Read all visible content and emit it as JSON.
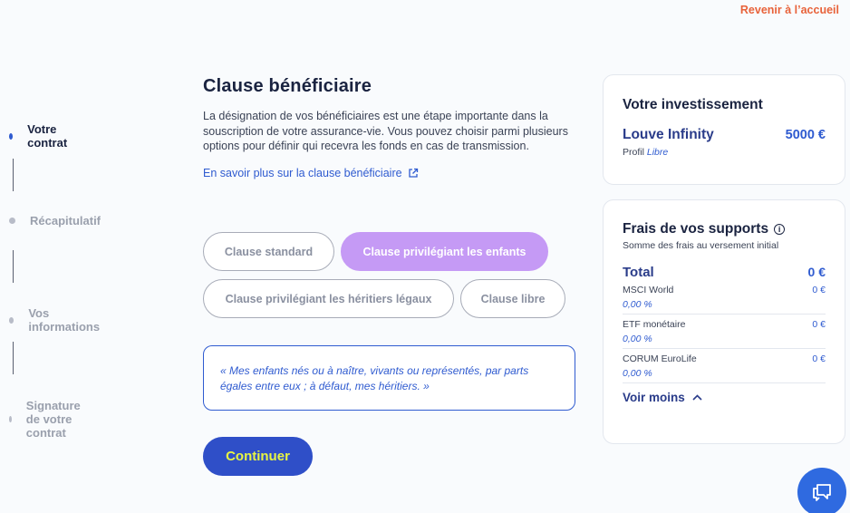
{
  "header": {
    "back_label": "Revenir à l’accueil"
  },
  "stepper": {
    "steps": [
      {
        "label": "Votre contrat"
      },
      {
        "label": "Récapitulatif"
      },
      {
        "label": "Vos informations"
      },
      {
        "label": "Signature de votre contrat"
      }
    ]
  },
  "main": {
    "title": "Clause bénéficiaire",
    "description": "La désignation de vos bénéficiaires est une étape importante dans la souscription de votre assurance-vie. Vous pouvez choisir parmi plusieurs options pour définir qui recevra les fonds en cas de transmission.",
    "learn_more": "En savoir plus sur la clause bénéficiaire",
    "options": [
      {
        "label": "Clause standard"
      },
      {
        "label": "Clause privilégiant les enfants"
      },
      {
        "label": "Clause privilégiant les héritiers légaux"
      },
      {
        "label": "Clause libre"
      }
    ],
    "selected_option": "Clause privilégiant les enfants",
    "clause_text": "« Mes enfants nés ou à naître, vivants ou représentés, par parts égales entre eux ; à défaut, mes héritiers. »",
    "continue_label": "Continuer"
  },
  "investment": {
    "title": "Votre investissement",
    "product": "Louve Infinity",
    "amount": "5000 €",
    "profil_label": "Profil",
    "profil_value": "Libre"
  },
  "fees": {
    "title": "Frais de vos supports",
    "subtitle": "Somme des frais au versement initial",
    "total_label": "Total",
    "total_value": "0 €",
    "funds": [
      {
        "name": "MSCI World",
        "amount": "0 €",
        "pct": "0,00 %"
      },
      {
        "name": "ETF monétaire",
        "amount": "0 €",
        "pct": "0,00 %"
      },
      {
        "name": "CORUM EuroLife",
        "amount": "0 €",
        "pct": "0,00 %"
      }
    ],
    "toggle_label": "Voir moins"
  },
  "colors": {
    "accent": "#2f5bd0",
    "selected_option": "#c59af5",
    "back_link": "#e8623a",
    "continue_bg": "#2f4fc8",
    "continue_text": "#e8f542"
  }
}
